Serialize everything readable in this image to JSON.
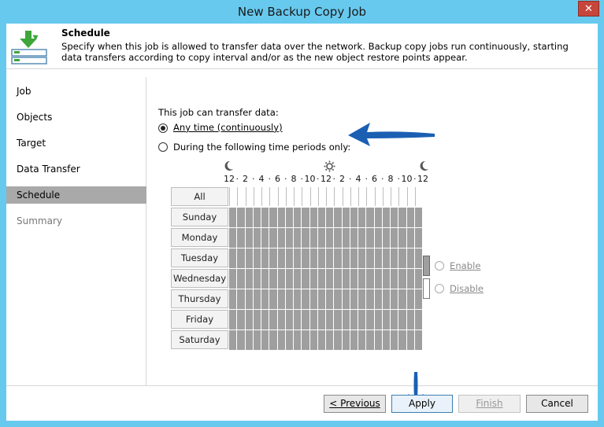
{
  "window": {
    "title": "New Backup Copy Job",
    "close_glyph": "✕"
  },
  "header": {
    "title": "Schedule",
    "description": "Specify when this job is allowed to transfer data over the network. Backup copy jobs run continuously, starting data transfers according to copy interval and/or as the new object restore points appear."
  },
  "sidebar": {
    "items": [
      {
        "label": "Job",
        "state": "normal"
      },
      {
        "label": "Objects",
        "state": "normal"
      },
      {
        "label": "Target",
        "state": "normal"
      },
      {
        "label": "Data Transfer",
        "state": "normal"
      },
      {
        "label": "Schedule",
        "state": "active"
      },
      {
        "label": "Summary",
        "state": "disabled"
      }
    ]
  },
  "main": {
    "intro": "This job can transfer data:",
    "option_any": "Any time (continuously)",
    "option_periods": "During the following time periods only:",
    "selected_option": "any"
  },
  "schedule": {
    "hour_ticks": [
      "12",
      "2",
      "4",
      "6",
      "8",
      "10",
      "12",
      "2",
      "4",
      "6",
      "8",
      "10",
      "12"
    ],
    "hour_ticks_wide": [
      "10",
      "10"
    ],
    "moon_icon": "moon-icon",
    "sun_icon": "sun-icon",
    "all_label": "All",
    "days": [
      "Sunday",
      "Monday",
      "Tuesday",
      "Wednesday",
      "Thursday",
      "Friday",
      "Saturday"
    ],
    "enable_label": "Enable",
    "disable_label": "Disable"
  },
  "footer": {
    "previous": "< Previous",
    "apply": "Apply",
    "finish": "Finish",
    "cancel": "Cancel"
  },
  "colors": {
    "title_bar": "#67c9ee",
    "active_nav": "#a9a9a9",
    "cell_fill": "#9f9f9f",
    "annotation_arrow": "#1b5fb3"
  }
}
